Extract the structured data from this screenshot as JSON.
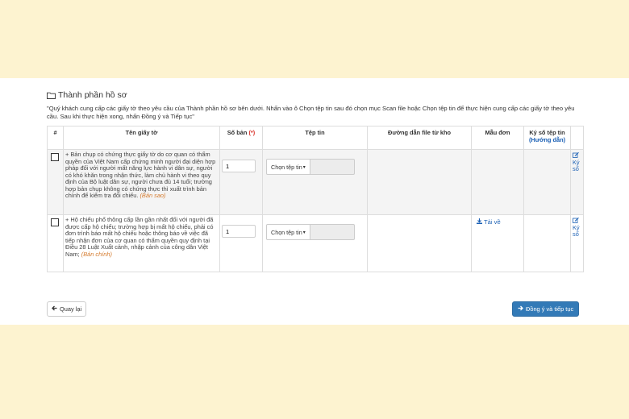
{
  "section": {
    "title": "Thành phần hồ sơ",
    "instructions": "\"Quý khách cung cấp các giấy tờ theo yêu cầu của Thành phần hồ sơ bên dưới. Nhấn vào ô Chọn tệp tin sau đó chọn mục Scan file hoặc Chọn tệp tin để thực hiện cung cấp các giấy tờ theo yêu cầu. Sau khi thực hiện xong, nhấn Đồng ý và Tiếp tục\""
  },
  "table": {
    "headers": {
      "index": "#",
      "name": "Tên giấy tờ",
      "copies": "Số bản",
      "copies_required": "(*)",
      "file": "Tệp tin",
      "scan_path": "Đường dẫn file từ kho",
      "template": "Mẫu đơn",
      "sign": "Ký số tệp tin",
      "sign_guide": "(Hướng dẫn)"
    },
    "rows": [
      {
        "description": "+ Bản chụp có chứng thực giấy tờ do cơ quan có thẩm quyền của Việt Nam cấp chứng minh người đại diện hợp pháp đối với người mất năng lực hành vi dân sự, người có khó khăn trong nhận thức, làm chủ hành vi theo quy định của Bộ luật dân sự, người chưa đủ 14 tuổi; trường hợp bản chụp không có chứng thực thì xuất trình bản chính để kiểm tra đối chiếu.",
        "note": "(Bản sao)",
        "copies": "1",
        "choose_file": "Chọn tệp tin",
        "template": "",
        "sign_label": "Ký số"
      },
      {
        "description": "+ Hộ chiếu phổ thông cấp lần gần nhất đối với người đã được cấp hộ chiếu; trường hợp bị mất hộ chiếu, phải có đơn trình báo mất hộ chiếu hoặc thông báo về việc đã tiếp nhận đơn của cơ quan có thẩm quyền quy định tại Điều 28 Luật Xuất cảnh, nhập cảnh của công dân Việt Nam;",
        "note": "(Bản chính)",
        "copies": "1",
        "choose_file": "Chọn tệp tin",
        "template": "Tải về",
        "sign_label": "Ký số"
      }
    ]
  },
  "footer": {
    "back_label": "Quay lại",
    "agree_label": "Đồng ý và tiếp tục"
  },
  "colors": {
    "background": "#fdf3d0",
    "primary": "#337ab7",
    "link": "#1a5fb4",
    "required": "#d9342b",
    "note": "#d57b2e"
  }
}
